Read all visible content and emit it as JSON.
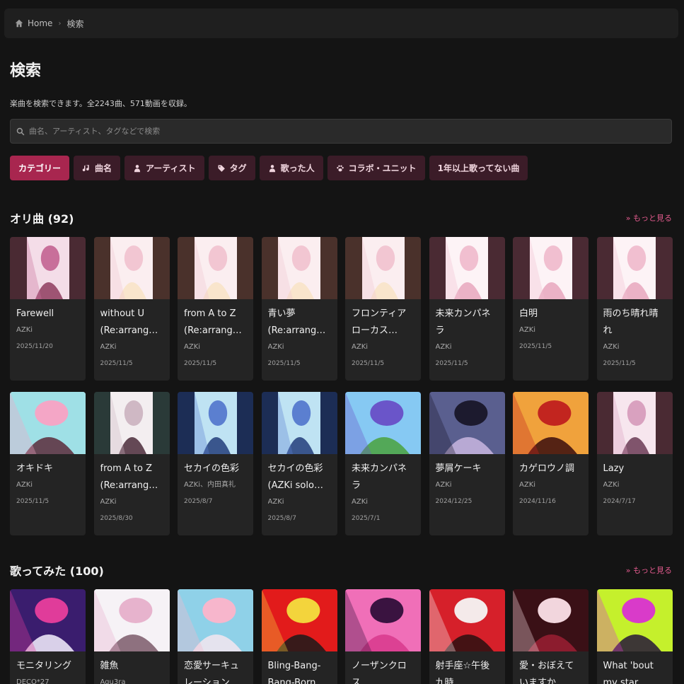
{
  "breadcrumb": {
    "home": "Home",
    "current": "検索"
  },
  "page": {
    "title": "検索",
    "description": "楽曲を検索できます。全2243曲、571動画を収録。"
  },
  "search": {
    "placeholder": "曲名、アーティスト、タグなどで検索"
  },
  "filters": [
    {
      "label": "カテゴリー",
      "icon": "none",
      "active": true
    },
    {
      "label": "曲名",
      "icon": "music-note-icon"
    },
    {
      "label": "アーティスト",
      "icon": "person-icon"
    },
    {
      "label": "タグ",
      "icon": "tag-icon"
    },
    {
      "label": "歌った人",
      "icon": "person-icon"
    },
    {
      "label": "コラボ・ユニット",
      "icon": "paw-icon"
    },
    {
      "label": "1年以上歌ってない曲",
      "icon": "none"
    }
  ],
  "sections": [
    {
      "title": "オリ曲 (92)",
      "more": "» もっと見る",
      "cards": [
        {
          "title": "Farewell",
          "artist": "AZKi",
          "date": "2025/11/20",
          "bg": "#4a2a33",
          "art": [
            "#f4dde8",
            "#c86f9a",
            "#8e3c5e"
          ]
        },
        {
          "title": "without U (Re:arrange ver.)",
          "artist": "AZKi",
          "date": "2025/11/5",
          "bg": "#4a312b",
          "art": [
            "#fbeef0",
            "#f2c6d2",
            "#f8e3c6"
          ]
        },
        {
          "title": "from A to Z (Re:arrange ver.)",
          "artist": "AZKi",
          "date": "2025/11/5",
          "bg": "#4a312b",
          "art": [
            "#fbeef0",
            "#f2c6d2",
            "#f8e3c6"
          ]
        },
        {
          "title": "青い夢 (Re:arrange ver.)",
          "artist": "AZKi",
          "date": "2025/11/5",
          "bg": "#4a312b",
          "art": [
            "#fbeef0",
            "#f2c6d2",
            "#f8e3c6"
          ]
        },
        {
          "title": "フロンティアローカス (Re:arrange ver.)",
          "artist": "AZKi",
          "date": "2025/11/5",
          "bg": "#4a312b",
          "art": [
            "#fbeef0",
            "#f2c6d2",
            "#f8e3c6"
          ]
        },
        {
          "title": "未来カンパネラ",
          "artist": "AZKi",
          "date": "2025/11/5",
          "bg": "#4a2a33",
          "art": [
            "#fdf3f6",
            "#f1bfd0",
            "#e7a6bd"
          ]
        },
        {
          "title": "白明",
          "artist": "AZKi",
          "date": "2025/11/5",
          "bg": "#4a2a33",
          "art": [
            "#fdf3f6",
            "#f1bfd0",
            "#e7a6bd"
          ]
        },
        {
          "title": "雨のち晴れ晴れ",
          "artist": "AZKi",
          "date": "2025/11/5",
          "bg": "#4a2a33",
          "art": [
            "#fdf3f6",
            "#f1bfd0",
            "#e7a6bd"
          ]
        }
      ]
    },
    {
      "cards": [
        {
          "title": "オキドキ",
          "artist": "AZKi",
          "date": "2025/11/5",
          "bg": "#ffffff",
          "art": [
            "#9fe0e6",
            "#f4a6c6",
            "#5a2a3a"
          ],
          "full": true
        },
        {
          "title": "from A to Z (Re:arrange ver.)",
          "artist": "AZKi",
          "date": "2025/8/30",
          "bg": "#2a3a38",
          "art": [
            "#f3eef0",
            "#cfb8c4",
            "#4a2a3a"
          ]
        },
        {
          "title": "セカイの色彩",
          "artist": "AZKi、内田真礼",
          "date": "2025/8/7",
          "bg": "#1c2d55",
          "art": [
            "#bfe3f3",
            "#5b7fd0",
            "#223d7a"
          ]
        },
        {
          "title": "セカイの色彩 (AZKi solo ver.)",
          "artist": "AZKi",
          "date": "2025/8/7",
          "bg": "#1c2d55",
          "art": [
            "#bfe3f3",
            "#5b7fd0",
            "#223d7a"
          ]
        },
        {
          "title": "未来カンパネラ",
          "artist": "AZKi",
          "date": "2025/7/1",
          "bg": "#2c3a8a",
          "art": [
            "#86c9f3",
            "#6a55c9",
            "#4aa23c"
          ],
          "full": true
        },
        {
          "title": "夢屑ケーキ",
          "artist": "AZKi",
          "date": "2024/12/25",
          "bg": "#1f1b33",
          "art": [
            "#5a5f8f",
            "#1c1a2e",
            "#c9b6e0"
          ],
          "full": true
        },
        {
          "title": "カゲロウノ調",
          "artist": "AZKi",
          "date": "2024/11/16",
          "bg": "#2a0c0c",
          "art": [
            "#f0a23c",
            "#c2251f",
            "#3a0d0d"
          ],
          "full": true
        },
        {
          "title": "Lazy",
          "artist": "AZKi",
          "date": "2024/7/17",
          "bg": "#4a2a33",
          "art": [
            "#f7e6ee",
            "#d9a1bf",
            "#6b3a55"
          ]
        }
      ]
    },
    {
      "title": "歌ってみた (100)",
      "more": "» もっと見る",
      "cards": [
        {
          "title": "モニタリング",
          "artist": "DECO*27",
          "date": "",
          "bg": "#141414",
          "art": [
            "#3a1d6e",
            "#e03c9a",
            "#f6f0ff"
          ],
          "full": true
        },
        {
          "title": "雑魚",
          "artist": "Aqu3ra",
          "date": "",
          "bg": "#f4f2f4",
          "art": [
            "#f6f2f6",
            "#e7b3cd",
            "#7b5a6a"
          ],
          "full": true
        },
        {
          "title": "恋愛サーキュレーション",
          "artist": "",
          "date": "",
          "bg": "#cfe7f2",
          "art": [
            "#8fd1e8",
            "#f7b6cc",
            "#f4e6ef"
          ],
          "full": true
        },
        {
          "title": "Bling-Bang-Bang-Born",
          "artist": "",
          "date": "",
          "bg": "#c8141c",
          "art": [
            "#e21b1b",
            "#f3d43c",
            "#1a1a1a"
          ],
          "full": true
        },
        {
          "title": "ノーザンクロス",
          "artist": "",
          "date": "",
          "bg": "#2a0f2e",
          "art": [
            "#f06fb8",
            "#3a1340",
            "#d83a8c"
          ],
          "full": true
        },
        {
          "title": "射手座☆午後九時",
          "artist": "",
          "date": "",
          "bg": "#1a0d0d",
          "art": [
            "#d6202a",
            "#f4eaea",
            "#2a1010"
          ],
          "full": true
        },
        {
          "title": "愛・おぼえていますか",
          "artist": "",
          "date": "",
          "bg": "#2a0b10",
          "art": [
            "#3a1016",
            "#f2d6dd",
            "#9b1f33"
          ],
          "full": true
        },
        {
          "title": "What 'bout my star",
          "artist": "",
          "date": "",
          "bg": "#1d1230",
          "art": [
            "#c5f02c",
            "#d93bc9",
            "#251638"
          ],
          "full": true
        }
      ]
    }
  ]
}
